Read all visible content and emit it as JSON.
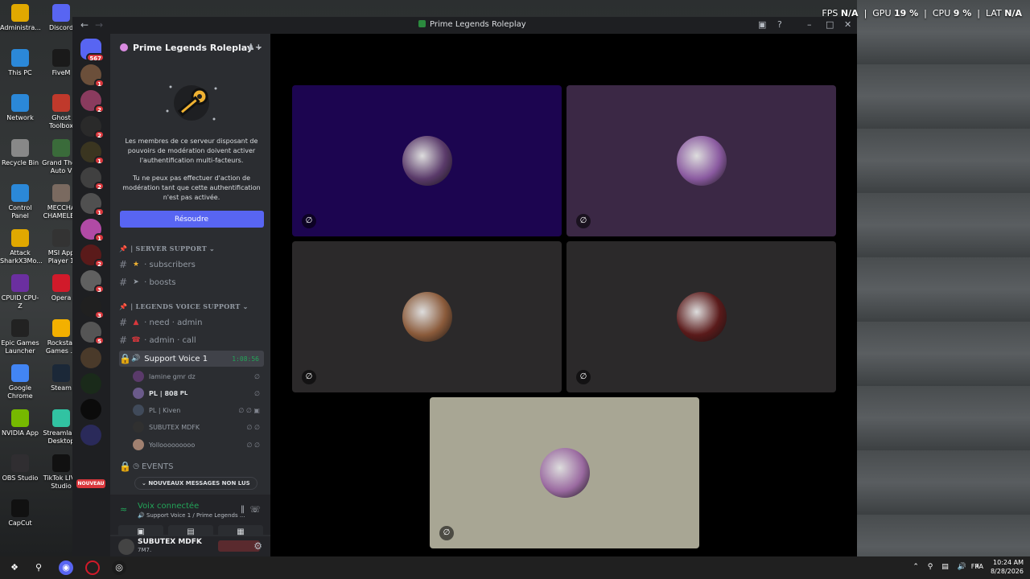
{
  "sysinfo": {
    "fps_label": "FPS",
    "fps": "N/A",
    "gpu_label": "GPU",
    "gpu": "19 %",
    "cpu_label": "CPU",
    "cpu": "9 %",
    "lat_label": "LAT",
    "lat": "N/A"
  },
  "desktop_icons": [
    {
      "label": "Administra...",
      "icon": "folder-icon",
      "color": "#e0a800"
    },
    {
      "label": "Discord",
      "icon": "discord-icon",
      "color": "#5865f2"
    },
    {
      "label": "This PC",
      "icon": "monitor-icon",
      "color": "#2b88d8"
    },
    {
      "label": "FiveM",
      "icon": "fivem-icon",
      "color": "#1a1a1a"
    },
    {
      "label": "Network",
      "icon": "network-icon",
      "color": "#2b88d8"
    },
    {
      "label": "Ghost Toolbox",
      "icon": "ghost-icon",
      "color": "#c0392b"
    },
    {
      "label": "Recycle Bin",
      "icon": "recycle-bin-icon",
      "color": "#888"
    },
    {
      "label": "Grand Theft Auto V",
      "icon": "gta-icon",
      "color": "#3a6b3a"
    },
    {
      "label": "Control Panel",
      "icon": "control-panel-icon",
      "color": "#2b88d8"
    },
    {
      "label": "MECCHA CHAMELEO",
      "icon": "app-icon",
      "color": "#7a6a60"
    },
    {
      "label": "Attack SharkX3Mo...",
      "icon": "mouse-icon",
      "color": "#e0a800"
    },
    {
      "label": "MSI App Player 1",
      "icon": "msi-icon",
      "color": "#333"
    },
    {
      "label": "CPUID CPU-Z",
      "icon": "cpuz-icon",
      "color": "#6b2fa0"
    },
    {
      "label": "Opera",
      "icon": "opera-icon",
      "color": "#d11a2a"
    },
    {
      "label": "Epic Games Launcher",
      "icon": "epic-icon",
      "color": "#222"
    },
    {
      "label": "Rockstar Games ...",
      "icon": "rockstar-icon",
      "color": "#f3b000"
    },
    {
      "label": "Google Chrome",
      "icon": "chrome-icon",
      "color": "#4285f4"
    },
    {
      "label": "Steam",
      "icon": "steam-icon",
      "color": "#1b2838"
    },
    {
      "label": "NVIDIA App",
      "icon": "nvidia-icon",
      "color": "#76b900"
    },
    {
      "label": "Streamlabs Desktop",
      "icon": "streamlabs-icon",
      "color": "#31c3a2"
    },
    {
      "label": "OBS Studio",
      "icon": "obs-icon",
      "color": "#302e31"
    },
    {
      "label": "TikTok LIVE Studio",
      "icon": "tiktok-icon",
      "color": "#111"
    },
    {
      "label": "CapCut",
      "icon": "capcut-icon",
      "color": "#111"
    }
  ],
  "window": {
    "title": "Prime Legends Roleplay"
  },
  "rail": {
    "home_badge": "567",
    "servers": [
      {
        "badge": "1",
        "color": "#6b4f3a"
      },
      {
        "badge": "2",
        "color": "#8a3b5e"
      },
      {
        "badge": "2",
        "color": "#2a2a2a"
      },
      {
        "badge": "1",
        "color": "#3a3520"
      },
      {
        "badge": "2",
        "color": "#404040"
      },
      {
        "badge": "1",
        "color": "#505050"
      },
      {
        "badge": "1",
        "color": "#b14aa5"
      },
      {
        "badge": "2",
        "color": "#5a1a1a"
      },
      {
        "badge": "3",
        "color": "#606060"
      },
      {
        "badge": "3",
        "color": "#202020"
      },
      {
        "badge": "5",
        "color": "#555"
      },
      {
        "badge": "",
        "color": "#4a3a2a"
      },
      {
        "badge": "",
        "color": "#1a2a1a"
      },
      {
        "badge": "",
        "color": "#0b0b0b"
      },
      {
        "badge": "",
        "color": "#2a2a5a"
      }
    ],
    "nouveau": "NOUVEAU"
  },
  "server": {
    "name": "Prime Legends Roleplay"
  },
  "mfa": {
    "paragraph1": "Les membres de ce serveur disposant de pouvoirs de modération doivent activer l'authentification multi-facteurs.",
    "paragraph2": "Tu ne peux pas effectuer d'action de modération tant que cette authentification n'est pas activée.",
    "button": "Résoudre"
  },
  "categories": [
    {
      "name": "| SERVER SUPPORT"
    },
    {
      "name": "| LEGENDS VOICE SUPPORT"
    }
  ],
  "channels": {
    "subscribers": "subscribers",
    "boosts": "boosts",
    "need_admin_a": "need",
    "need_admin_b": "admin",
    "admin_call_a": "admin",
    "admin_call_b": "call",
    "support_voice": "Support Voice 1",
    "support_voice_timer": "1:08:56",
    "events": "EVENTS"
  },
  "members": [
    {
      "name": "lamine gmr dz",
      "color": "#5a3a6a"
    },
    {
      "name": "PL | 808",
      "color": "#6a5a8a",
      "tag": "PL"
    },
    {
      "name": "PL | Kiven",
      "color": "#404a5a"
    },
    {
      "name": "SUBUTEX MDFK",
      "color": "#303030"
    },
    {
      "name": "Yollooooooooo",
      "color": "#a08070"
    }
  ],
  "new_messages": "NOUVEAUX MESSAGES NON LUS",
  "voice": {
    "title": "Voix connectée",
    "subtitle": "Support Voice 1 / Prime Legends ..."
  },
  "user": {
    "name": "SUBUTEX MDFK",
    "status": "7M7."
  },
  "tiles": [
    {
      "bg": "#1c0550",
      "avatar": "#5a3a6a"
    },
    {
      "bg": "#3b2845",
      "avatar": "#8a5aa0"
    },
    {
      "bg": "#2b292a",
      "avatar": "#8a5a3a"
    },
    {
      "bg": "#2b292a",
      "avatar": "#5a1a1a"
    },
    {
      "bg": "#a8a694",
      "avatar": "#9a6aa0"
    }
  ],
  "tray": {
    "lang": "FRA",
    "time": "10:24 AM",
    "date": "8/28/2026"
  }
}
